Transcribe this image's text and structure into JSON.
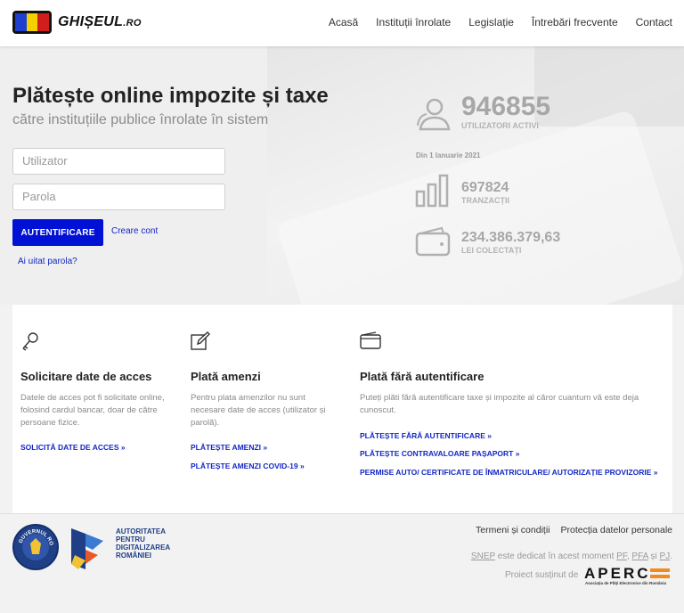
{
  "header": {
    "logo_text": "GHIȘEUL",
    "logo_suffix": ".RO",
    "flag_colors": [
      "#1f3fd0",
      "#f5d000",
      "#d21d1d"
    ],
    "nav": [
      "Acasă",
      "Instituții înrolate",
      "Legislație",
      "Întrebări frecvente",
      "Contact"
    ]
  },
  "hero": {
    "title": "Plătește online impozite și taxe",
    "subtitle": "către instituțiile publice înrolate în sistem",
    "username_placeholder": "Utilizator",
    "password_placeholder": "Parola",
    "login_label": "AUTENTIFICARE",
    "create_account_label": "Creare cont",
    "forgot_password_label": "Ai uitat parola?"
  },
  "stats": {
    "users_value": "946855",
    "users_label": "UTILIZATORI ACTIVI",
    "since_label": "Din 1 Ianuarie 2021",
    "transactions_value": "697824",
    "transactions_label": "TRANZACȚII",
    "collected_value": "234.386.379,63",
    "collected_label": "LEI COLECTAȚI"
  },
  "cards": [
    {
      "icon": "key-icon",
      "title": "Solicitare date de acces",
      "text": "Datele de acces pot fi solicitate online, folosind cardul bancar, doar de către persoane fizice.",
      "links": [
        "SOLICITĂ DATE DE ACCES »"
      ]
    },
    {
      "icon": "edit-icon",
      "title": "Plată amenzi",
      "text": "Pentru plata amenzilor nu sunt necesare date de acces (utilizator și parolă).",
      "links": [
        "PLĂTEȘTE AMENZI »",
        "PLĂTEȘTE AMENZI COVID-19 »"
      ]
    },
    {
      "icon": "wallet-icon",
      "title": "Plată fără autentificare",
      "text": "Puteți plăti fără autentificare taxe și impozite al căror cuantum vă este deja cunoscut.",
      "links": [
        "PLĂTEȘTE FĂRĂ AUTENTIFICARE »",
        "PLĂTEȘTE CONTRAVALOARE PAȘAPORT »",
        "PERMISE AUTO/ CERTIFICATE DE ÎNMATRICULARE/ AUTORIZAȚIE PROVIZORIE »"
      ]
    }
  ],
  "footer": {
    "seal_text": "GUVERNUL ROMÂNIEI",
    "adr_lines": [
      "AUTORITATEA",
      "PENTRU",
      "DIGITALIZAREA",
      "ROMÂNIEI"
    ],
    "links": [
      "Termeni și condiții",
      "Protecția datelor personale"
    ],
    "snep": "SNEP",
    "snep_text": " este dedicat în acest moment ",
    "pf": "PF",
    "sep1": ", ",
    "pfa": "PFA",
    "sep2": " și ",
    "pj": "PJ",
    "end": ".",
    "project_label": "Proiect susținut de",
    "aperc": "APERC",
    "aperc_sub": "Asociația de Plăți Electronice din România"
  }
}
